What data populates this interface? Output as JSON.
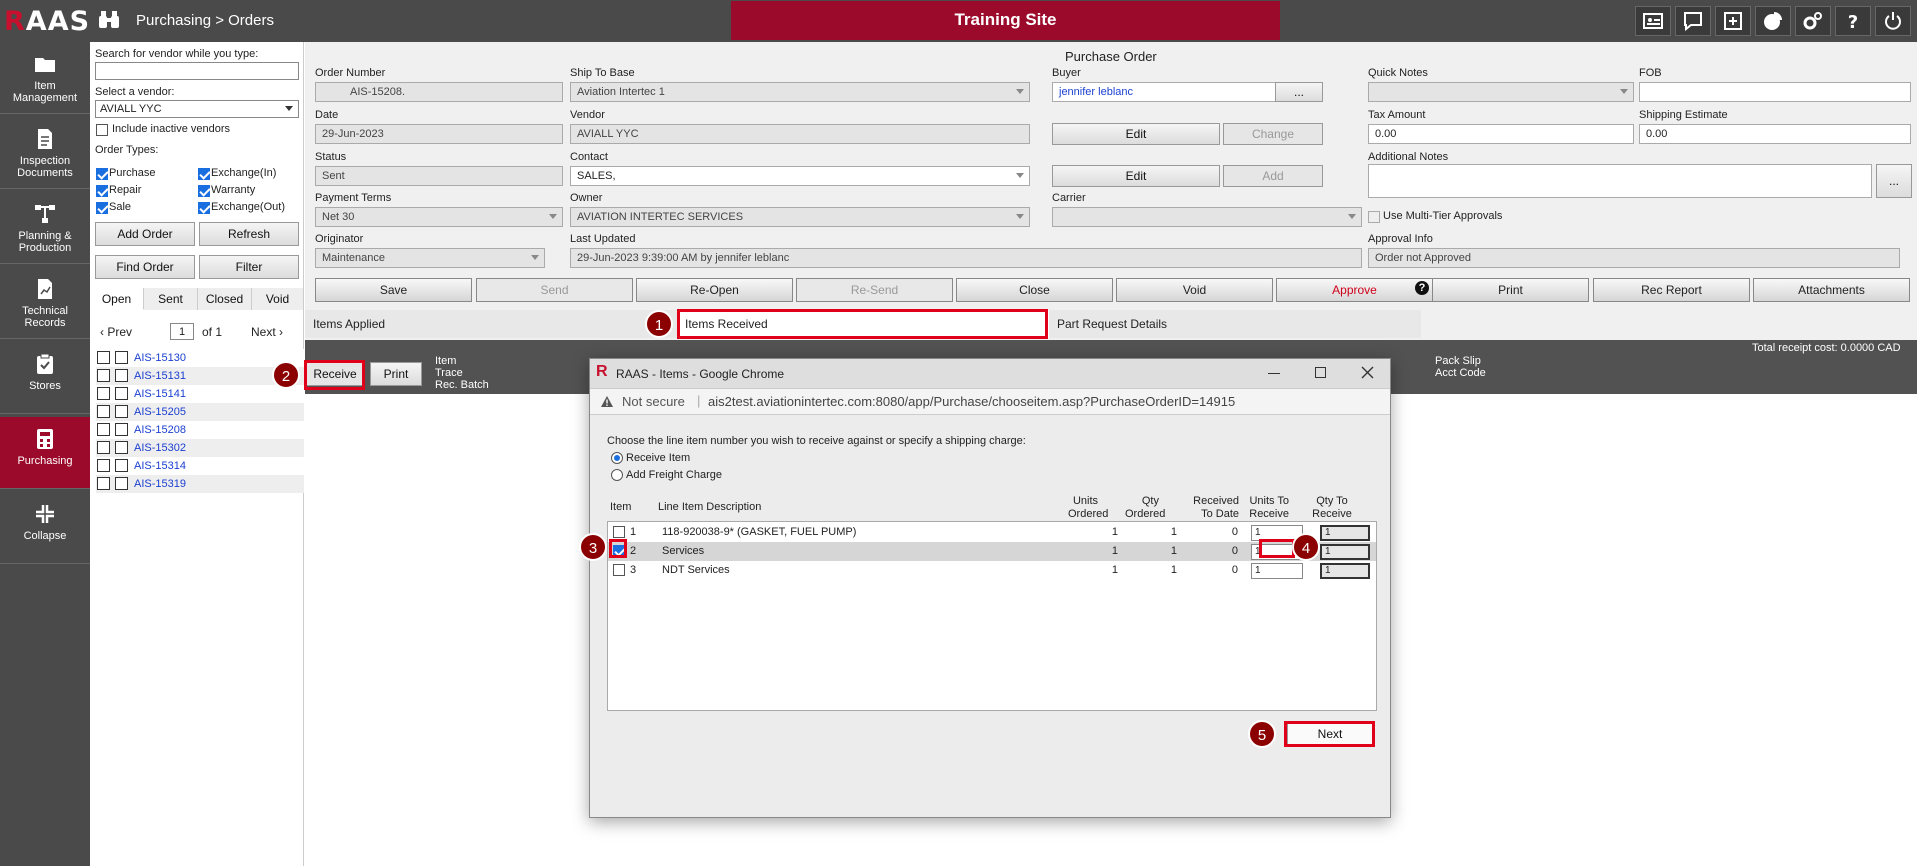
{
  "header": {
    "logo_r": "R",
    "logo_rest": "AAS",
    "breadcrumb": "Purchasing > Orders",
    "training_banner": "Training Site",
    "icons": [
      "id-card-icon",
      "chat-icon",
      "plus-box-icon",
      "pie-chart-icon",
      "gears-icon",
      "help-icon",
      "power-icon"
    ]
  },
  "sidebar": {
    "items": [
      {
        "label": "Item Management",
        "icon": "folder-icon"
      },
      {
        "label": "Inspection Documents",
        "icon": "document-icon"
      },
      {
        "label": "Planning & Production",
        "icon": "flow-icon"
      },
      {
        "label": "Technical Records",
        "icon": "chart-doc-icon"
      },
      {
        "label": "Stores",
        "icon": "clipboard-check-icon"
      },
      {
        "label": "Purchasing",
        "icon": "calculator-icon"
      },
      {
        "label": "Collapse",
        "icon": "collapse-icon"
      }
    ]
  },
  "vendor_panel": {
    "search_label": "Search for vendor while you type:",
    "search_value": "",
    "select_label": "Select a vendor:",
    "vendor_selected": "AVIALL YYC",
    "include_inactive": "Include inactive vendors",
    "order_types_label": "Order Types:",
    "types": [
      "Purchase",
      "Exchange(In)",
      "Repair",
      "Warranty",
      "Sale",
      "Exchange(Out)"
    ],
    "add_order": "Add Order",
    "refresh": "Refresh",
    "find_order": "Find Order",
    "filter": "Filter",
    "tabs": [
      "Open",
      "Sent",
      "Closed",
      "Void"
    ],
    "prev": "Prev",
    "page_value": "1",
    "of_label": "of 1",
    "next": "Next",
    "orders": [
      "AIS-15130",
      "AIS-15131",
      "AIS-15141",
      "AIS-15205",
      "AIS-15208",
      "AIS-15302",
      "AIS-15314",
      "AIS-15319"
    ]
  },
  "form": {
    "title": "Purchase Order",
    "order_number_label": "Order Number",
    "order_number": "AIS-15208.",
    "ship_to_label": "Ship To Base",
    "ship_to": "Aviation Intertec 1",
    "buyer_label": "Buyer",
    "buyer": "jennifer leblanc",
    "buyer_btn": "...",
    "quick_notes_label": "Quick Notes",
    "fob_label": "FOB",
    "date_label": "Date",
    "date": "29-Jun-2023",
    "vendor_label": "Vendor",
    "vendor": "AVIALL YYC",
    "edit1": "Edit",
    "change": "Change",
    "tax_label": "Tax Amount",
    "tax": "0.00",
    "shipping_label": "Shipping Estimate",
    "shipping": "0.00",
    "status_label": "Status",
    "status": "Sent",
    "contact_label": "Contact",
    "contact": "SALES,",
    "edit2": "Edit",
    "add": "Add",
    "additional_notes_label": "Additional Notes",
    "notes_btn": "...",
    "payment_label": "Payment Terms",
    "payment": "Net 30",
    "owner_label": "Owner",
    "owner": "AVIATION INTERTEC SERVICES",
    "carrier_label": "Carrier",
    "multi_tier": "Use Multi-Tier Approvals",
    "originator_label": "Originator",
    "originator": "Maintenance",
    "last_updated_label": "Last Updated",
    "last_updated": "29-Jun-2023 9:39:00 AM by jennifer leblanc",
    "approval_label": "Approval Info",
    "approval": "Order not Approved",
    "actions": [
      "Save",
      "Send",
      "Re-Open",
      "Re-Send",
      "Close",
      "Void",
      "Approve"
    ],
    "actions_right": [
      "Print",
      "Rec Report",
      "Attachments"
    ],
    "help": "?",
    "subtabs": [
      "Items Applied",
      "Items Received",
      "Part Request Details"
    ]
  },
  "received_bar": {
    "receive": "Receive",
    "print": "Print",
    "col1": "Item",
    "col2": "Trace",
    "col3": "Rec. Batch",
    "packslip": "Pack Slip",
    "acct": "Acct Code",
    "total": "Total receipt cost: 0.0000 CAD"
  },
  "dialog": {
    "logo": "R",
    "title": "RAAS - Items - Google Chrome",
    "not_secure": "Not secure",
    "url": "ais2test.aviationintertec.com:8080/app/Purchase/chooseitem.asp?PurchaseOrderID=14915",
    "prompt": "Choose the line item number you wish to receive against or specify a shipping charge:",
    "opt_receive": "Receive Item",
    "opt_freight": "Add Freight Charge",
    "headers": {
      "item": "Item",
      "desc": "Line Item Description",
      "units_ordered": "Units Ordered",
      "qty_ordered": "Qty Ordered",
      "received": "Received To Date",
      "units_to_receive": "Units To Receive",
      "qty_to_receive": "Qty To Receive"
    },
    "rows": [
      {
        "item": "1",
        "desc": "118-920038-9* (GASKET, FUEL PUMP)",
        "units_ordered": "1",
        "qty_ordered": "1",
        "received": "0",
        "units_to_receive": "1",
        "qty_to_receive": "1",
        "checked": false
      },
      {
        "item": "2",
        "desc": "Services",
        "units_ordered": "1",
        "qty_ordered": "1",
        "received": "0",
        "units_to_receive": "1",
        "qty_to_receive": "1",
        "checked": true
      },
      {
        "item": "3",
        "desc": "NDT Services",
        "units_ordered": "1",
        "qty_ordered": "1",
        "received": "0",
        "units_to_receive": "1",
        "qty_to_receive": "1",
        "checked": false
      }
    ],
    "next": "Next"
  },
  "callouts": [
    "1",
    "2",
    "3",
    "4",
    "5"
  ],
  "colors": {
    "brand": "#9b0a2a",
    "highlight": "#e0001a",
    "link": "#1a3fd0"
  }
}
